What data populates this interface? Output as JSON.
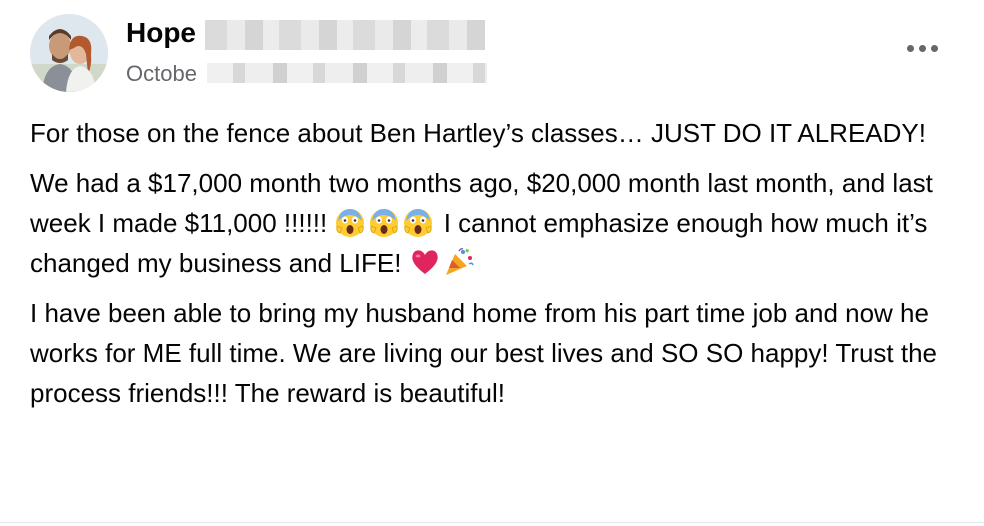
{
  "post": {
    "author_name": "Hope",
    "date": "Octobe",
    "paragraphs": {
      "p1": "For those on the fence about Ben Hartley’s classes… JUST DO IT ALREADY!",
      "p2a": "We had a $17,000 month two months ago, $20,000 month last month, and last week I made $11,000 !!!!!! ",
      "p2b": " I cannot emphasize enough how much it’s changed my business and LIFE! ",
      "p3": "I have been able to bring my husband home from his part time job and now he works for ME full time. We are living our best lives and SO SO happy! Trust the process friends!!! The reward is beautiful!"
    },
    "emoji_names": [
      "screaming-face-emoji",
      "screaming-face-emoji",
      "screaming-face-emoji",
      "red-heart-emoji",
      "party-popper-emoji"
    ]
  },
  "colors": {
    "text": "#050505",
    "secondary_text": "#65676b",
    "background": "#ffffff"
  }
}
